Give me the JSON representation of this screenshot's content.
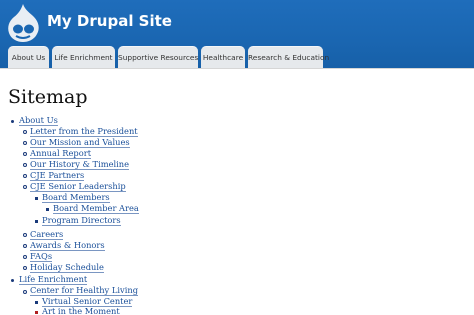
{
  "header": {
    "site_name": "My Drupal Site",
    "logo_icon": "drupal-drop-icon",
    "background_color": "#1a66b1"
  },
  "tabs": [
    {
      "label": "About Us"
    },
    {
      "label": "Life Enrichment"
    },
    {
      "label": "Supportive Resources"
    },
    {
      "label": "Healthcare"
    },
    {
      "label": "Research & Education"
    }
  ],
  "page": {
    "title": "Sitemap"
  },
  "sitemap": {
    "about_us": "About Us",
    "letter": "Letter from the President",
    "mission": "Our Mission and Values",
    "annual_report": "Annual Report",
    "history": "Our History & Timeline",
    "cje_partners": "CJE Partners",
    "cje_leadership": "CJE Senior Leadership",
    "board_members": "Board Members",
    "board_member_area": "Board Member Area",
    "program_directors": "Program Directors",
    "careers": "Careers",
    "awards": "Awards & Honors",
    "faqs": "FAQs",
    "holiday_schedule": "Holiday Schedule",
    "life_enrichment": "Life Enrichment",
    "healthy_living": "Center for Healthy Living",
    "virtual_senior_center": "Virtual Senior Center",
    "art_in_the_moment": "Art in the Moment"
  }
}
